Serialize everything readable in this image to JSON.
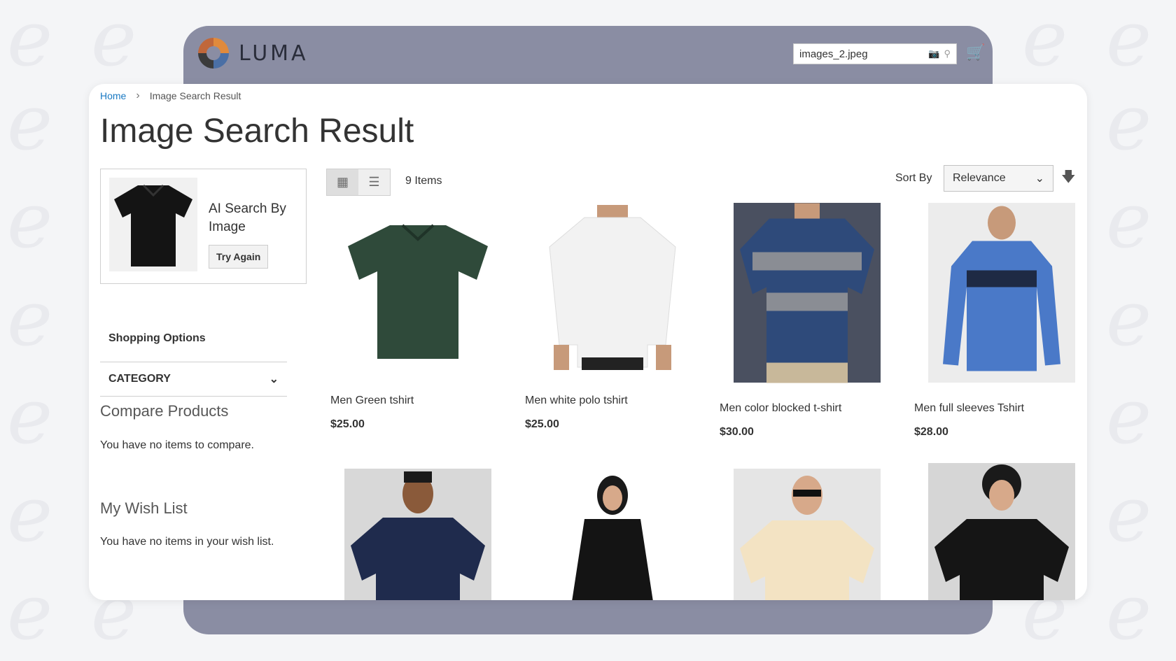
{
  "header": {
    "logo_text": "LUMA",
    "search_value": "images_2.jpeg",
    "camera_icon": "camera-icon",
    "search_icon": "search-icon",
    "cart_icon": "cart-icon"
  },
  "breadcrumb": {
    "home": "Home",
    "separator": "›",
    "current": "Image Search Result"
  },
  "page_title": "Image Search Result",
  "ai_search": {
    "title": "AI Search By Image",
    "button": "Try Again"
  },
  "sidebar": {
    "shopping_options": "Shopping Options",
    "category": "CATEGORY",
    "compare_title": "Compare Products",
    "compare_text": "You have no items to compare.",
    "wishlist_title": "My Wish List",
    "wishlist_text": "You have no items in your wish list."
  },
  "toolbar": {
    "items_count": "9 Items",
    "sort_label": "Sort By",
    "sort_value": "Relevance"
  },
  "products": [
    {
      "name": "Men Green tshirt",
      "price": "$25.00",
      "color": "#2f4a3a"
    },
    {
      "name": "Men white polo tshirt",
      "price": "$25.00",
      "color": "#f2f2f2"
    },
    {
      "name": "Men color blocked t-shirt",
      "price": "$30.00",
      "color": "#2e4a7a"
    },
    {
      "name": "Men full sleeves Tshirt",
      "price": "$28.00",
      "color": "#4a79c8"
    },
    {
      "name": "",
      "price": "",
      "color": "#1f2b4d"
    },
    {
      "name": "",
      "price": "",
      "color": "#141414"
    },
    {
      "name": "",
      "price": "",
      "color": "#f3e3c3"
    },
    {
      "name": "",
      "price": "",
      "color": "#151515"
    }
  ]
}
